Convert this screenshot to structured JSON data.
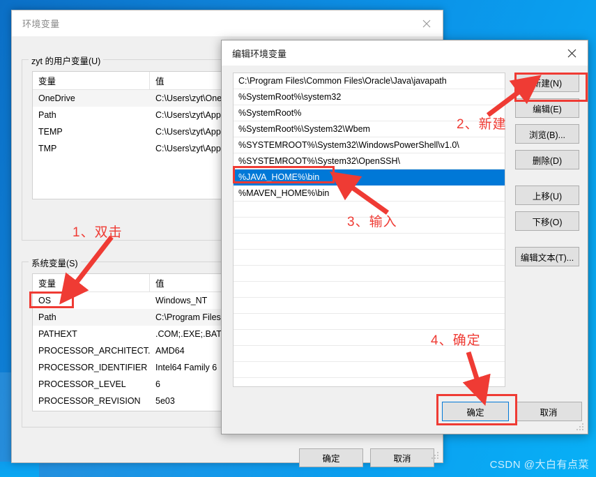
{
  "env_window": {
    "title": "环境变量",
    "close_icon": "close-icon",
    "user_group_legend": "zyt 的用户变量(U)",
    "system_group_legend": "系统变量(S)",
    "table_headers": [
      "变量",
      "值"
    ],
    "user_variables": [
      {
        "name": "OneDrive",
        "value": "C:\\Users\\zyt\\One"
      },
      {
        "name": "Path",
        "value": "C:\\Users\\zyt\\App"
      },
      {
        "name": "TEMP",
        "value": "C:\\Users\\zyt\\App"
      },
      {
        "name": "TMP",
        "value": "C:\\Users\\zyt\\App"
      }
    ],
    "system_variables": [
      {
        "name": "OS",
        "value": "Windows_NT"
      },
      {
        "name": "Path",
        "value": "C:\\Program Files"
      },
      {
        "name": "PATHEXT",
        "value": ".COM;.EXE;.BAT;."
      },
      {
        "name": "PROCESSOR_ARCHITECT...",
        "value": "AMD64"
      },
      {
        "name": "PROCESSOR_IDENTIFIER",
        "value": "Intel64 Family 6 "
      },
      {
        "name": "PROCESSOR_LEVEL",
        "value": "6"
      },
      {
        "name": "PROCESSOR_REVISION",
        "value": "5e03"
      }
    ],
    "ok_label": "确定",
    "cancel_label": "取消"
  },
  "edit_window": {
    "title": "编辑环境变量",
    "close_icon": "close-icon",
    "path_entries": [
      "C:\\Program Files\\Common Files\\Oracle\\Java\\javapath",
      "%SystemRoot%\\system32",
      "%SystemRoot%",
      "%SystemRoot%\\System32\\Wbem",
      "%SYSTEMROOT%\\System32\\WindowsPowerShell\\v1.0\\",
      "%SYSTEMROOT%\\System32\\OpenSSH\\",
      "%JAVA_HOME%\\bin",
      "%MAVEN_HOME%\\bin"
    ],
    "selected_index": 6,
    "empty_row_count": 11,
    "buttons": {
      "new": "新建(N)",
      "edit": "编辑(E)",
      "browse": "浏览(B)...",
      "delete": "删除(D)",
      "move_up": "上移(U)",
      "move_down": "下移(O)",
      "edit_text": "编辑文本(T)..."
    },
    "ok_label": "确定",
    "cancel_label": "取消"
  },
  "annotations": [
    {
      "id": "step1",
      "text": "1、双击"
    },
    {
      "id": "step2",
      "text": "2、新建"
    },
    {
      "id": "step3",
      "text": "3、输入"
    },
    {
      "id": "step4",
      "text": "4、确定"
    }
  ],
  "watermark": {
    "text": "CSDN @大白有点菜"
  },
  "colors": {
    "accent": "#0078d7",
    "annotation_red": "#ef3b34",
    "window_face": "#f0f0f0",
    "desktop_blue": "#0a8ee4"
  }
}
